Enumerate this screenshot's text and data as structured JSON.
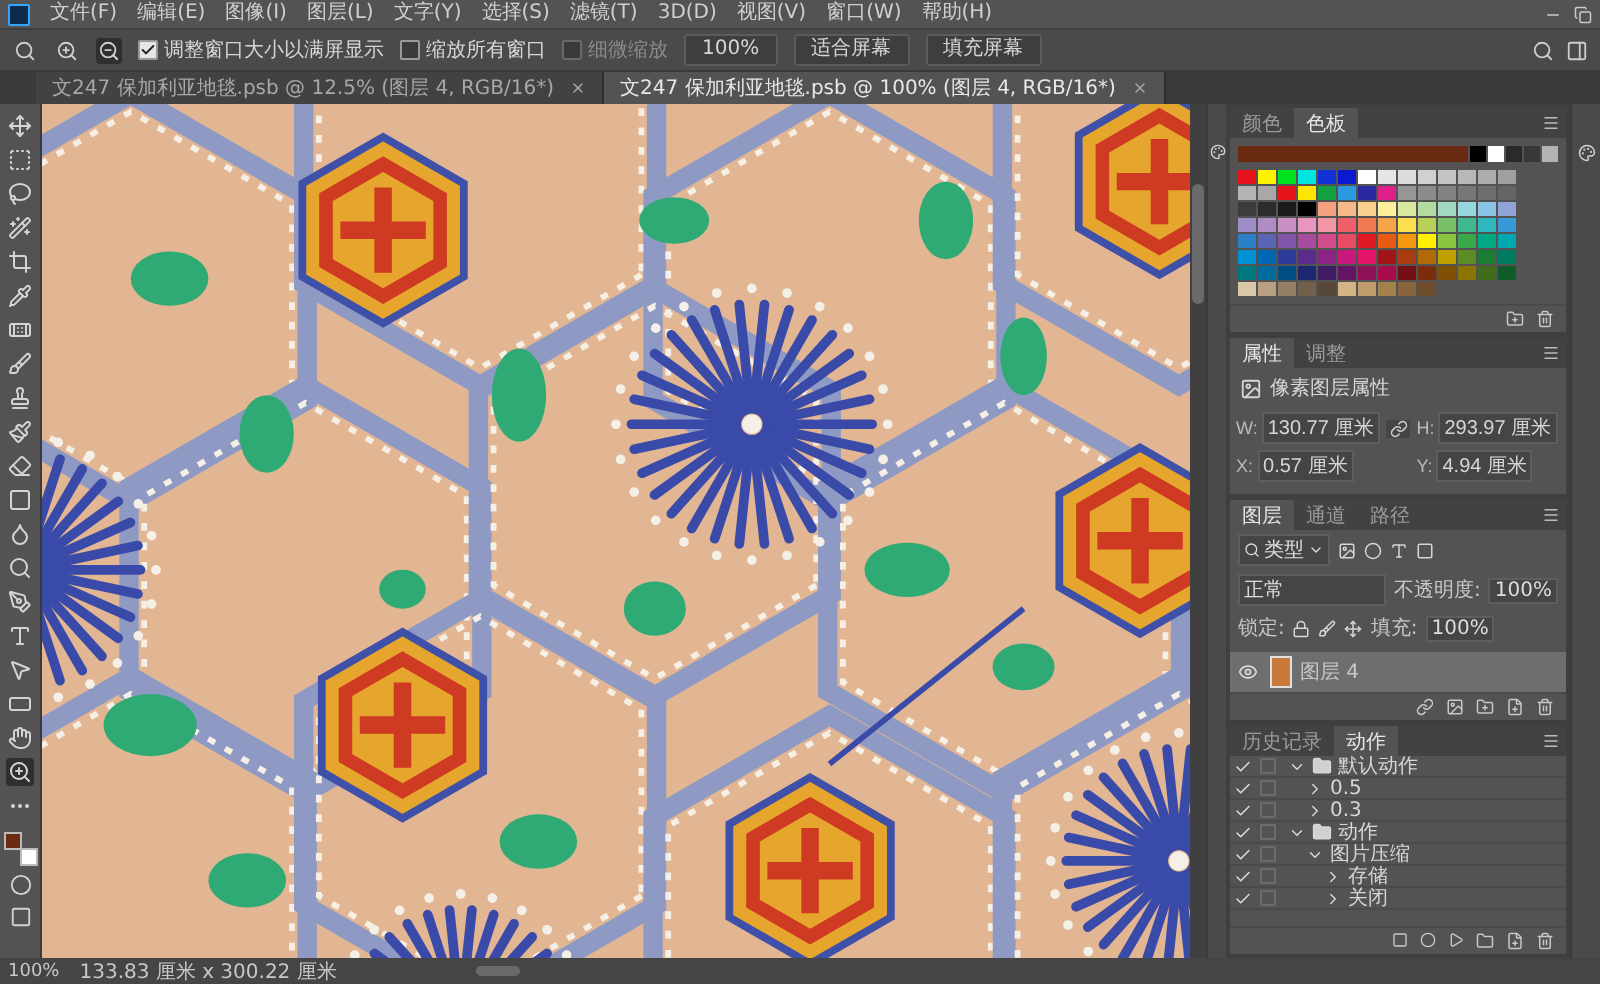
{
  "menu": [
    "文件(F)",
    "编辑(E)",
    "图像(I)",
    "图层(L)",
    "文字(Y)",
    "选择(S)",
    "滤镜(T)",
    "3D(D)",
    "视图(V)",
    "窗口(W)",
    "帮助(H)"
  ],
  "options_bar": {
    "checkboxes": [
      {
        "label": "调整窗口大小以满屏显示",
        "checked": true,
        "disabled": false
      },
      {
        "label": "缩放所有窗口",
        "checked": false,
        "disabled": false
      },
      {
        "label": "细微缩放",
        "checked": false,
        "disabled": true
      }
    ],
    "buttons": [
      "100%",
      "适合屏幕",
      "填充屏幕"
    ]
  },
  "doc_tabs": [
    {
      "label": "文247 保加利亚地毯.psb @ 12.5% (图层 4, RGB/16*)",
      "selected": false
    },
    {
      "label": "文247 保加利亚地毯.psb @ 100% (图层 4, RGB/16*)",
      "selected": true
    }
  ],
  "color_chips": [
    {
      "kind": "foreground",
      "color": "#6b2a12"
    },
    {
      "kind": "background",
      "color": "#ffffff"
    }
  ],
  "swatches_panel": {
    "tabs": [
      {
        "label": "颜色",
        "selected": false
      },
      {
        "label": "色板",
        "selected": true
      }
    ],
    "recent": [
      {
        "color": "#6b2a12"
      },
      {
        "color": "#000000"
      },
      {
        "color": "#ffffff"
      },
      {
        "color": "#2a2a2a"
      },
      {
        "color": "#383838"
      },
      {
        "color": "#b4b4b4"
      }
    ],
    "rows": [
      {
        "swatches": [
          {
            "color": "#e8141b"
          },
          {
            "color": "#fff200"
          },
          {
            "color": "#00e21f"
          },
          {
            "color": "#00e5e0"
          },
          {
            "color": "#1030d8"
          },
          {
            "color": "#0a1ad0"
          },
          {
            "color": "#ffffff"
          },
          {
            "color": "#e6e6e6"
          },
          {
            "color": "#dcdcdc"
          },
          {
            "color": "#d0d0d0"
          },
          {
            "color": "#c4c4c4"
          },
          {
            "color": "#b8b8b8"
          },
          {
            "color": "#acacac"
          },
          {
            "color": "#a0a0a0"
          }
        ]
      },
      {
        "swatches": [
          {
            "color": "#b4b4b4"
          },
          {
            "color": "#a8a8a8"
          },
          {
            "color": "#e8141c"
          },
          {
            "color": "#ffe600"
          },
          {
            "color": "#12a040"
          },
          {
            "color": "#2a9be0"
          },
          {
            "color": "#2a2aa0"
          },
          {
            "color": "#e0208a"
          },
          {
            "color": "#969696"
          },
          {
            "color": "#8c8c8c"
          },
          {
            "color": "#828282"
          },
          {
            "color": "#787878"
          },
          {
            "color": "#6e6e6e"
          },
          {
            "color": "#646464"
          }
        ]
      },
      {
        "swatches": [
          {
            "color": "#3c3c3c"
          },
          {
            "color": "#2c2c2c"
          },
          {
            "color": "#1a1a1a"
          },
          {
            "color": "#000000"
          },
          {
            "color": "#f4a27e"
          },
          {
            "color": "#f7b987"
          },
          {
            "color": "#fbd08e"
          },
          {
            "color": "#fdf09a"
          },
          {
            "color": "#d8e89c"
          },
          {
            "color": "#b4dca0"
          },
          {
            "color": "#a0d8c0"
          },
          {
            "color": "#98d6de"
          },
          {
            "color": "#8cc4e8"
          },
          {
            "color": "#90a4d8"
          }
        ]
      },
      {
        "swatches": [
          {
            "color": "#9c8cc8"
          },
          {
            "color": "#b08cc4"
          },
          {
            "color": "#c890c4"
          },
          {
            "color": "#e896c0"
          },
          {
            "color": "#f096a4"
          },
          {
            "color": "#f0606a"
          },
          {
            "color": "#f07a50"
          },
          {
            "color": "#f6a44a"
          },
          {
            "color": "#fde050"
          },
          {
            "color": "#b8d058"
          },
          {
            "color": "#78c068"
          },
          {
            "color": "#40b890"
          },
          {
            "color": "#30b8c0"
          },
          {
            "color": "#3898d8"
          }
        ]
      },
      {
        "swatches": [
          {
            "color": "#2c80c8"
          },
          {
            "color": "#5a64b4"
          },
          {
            "color": "#8054a8"
          },
          {
            "color": "#a84ca0"
          },
          {
            "color": "#d04c8c"
          },
          {
            "color": "#e84c64"
          },
          {
            "color": "#e01a22"
          },
          {
            "color": "#e85a14"
          },
          {
            "color": "#f49a10"
          },
          {
            "color": "#fff000"
          },
          {
            "color": "#8cc63e"
          },
          {
            "color": "#38a848"
          },
          {
            "color": "#00a884"
          },
          {
            "color": "#00a6b0"
          }
        ]
      },
      {
        "swatches": [
          {
            "color": "#0090d4"
          },
          {
            "color": "#0068b0"
          },
          {
            "color": "#2c3c98"
          },
          {
            "color": "#5a2c8c"
          },
          {
            "color": "#8c2488"
          },
          {
            "color": "#c8187c"
          },
          {
            "color": "#e4146a"
          },
          {
            "color": "#a01418"
          },
          {
            "color": "#a83c10"
          },
          {
            "color": "#b06a08"
          },
          {
            "color": "#c0a000"
          },
          {
            "color": "#5c8c28"
          },
          {
            "color": "#1c7c34"
          },
          {
            "color": "#007c60"
          }
        ]
      },
      {
        "swatches": [
          {
            "color": "#007880"
          },
          {
            "color": "#006c9c"
          },
          {
            "color": "#004c84"
          },
          {
            "color": "#1c2870"
          },
          {
            "color": "#401c68"
          },
          {
            "color": "#641464"
          },
          {
            "color": "#901058"
          },
          {
            "color": "#a80c4c"
          },
          {
            "color": "#741014"
          },
          {
            "color": "#7c2c0c"
          },
          {
            "color": "#805004"
          },
          {
            "color": "#8c7400"
          },
          {
            "color": "#406c1c"
          },
          {
            "color": "#105c28"
          }
        ]
      },
      {
        "swatches": [
          {
            "color": "#d8c8a8"
          },
          {
            "color": "#b8a080"
          },
          {
            "color": "#948064"
          },
          {
            "color": "#70604c"
          },
          {
            "color": "#584838"
          },
          {
            "color": "#d4b484"
          },
          {
            "color": "#c09c6c"
          },
          {
            "color": "#a4804c"
          },
          {
            "color": "#88643c"
          },
          {
            "color": "#6c4c2c"
          }
        ]
      }
    ]
  },
  "properties_panel": {
    "tabs": [
      {
        "label": "属性",
        "selected": true
      },
      {
        "label": "调整",
        "selected": false
      }
    ],
    "title": "像素图层属性",
    "fields": [
      {
        "label": "W:",
        "value": "130.77 厘米"
      },
      {
        "label": "H:",
        "value": "293.97 厘米"
      },
      {
        "label": "X:",
        "value": "0.57 厘米"
      },
      {
        "label": "Y:",
        "value": "4.94 厘米"
      }
    ]
  },
  "layers_panel": {
    "tabs": [
      {
        "label": "图层",
        "selected": true
      },
      {
        "label": "通道",
        "selected": false
      },
      {
        "label": "路径",
        "selected": false
      }
    ],
    "filter": "类型",
    "blend_mode": "正常",
    "opacity_label": "不透明度:",
    "opacity": "100%",
    "lock_label": "锁定:",
    "fill_label": "填充:",
    "fill": "100%",
    "layers": [
      {
        "name": "图层 4",
        "visible": true,
        "selected": true
      }
    ]
  },
  "actions_panel": {
    "tabs": [
      {
        "label": "历史记录",
        "selected": false
      },
      {
        "label": "动作",
        "selected": true
      }
    ],
    "items": [
      {
        "name": "默认动作",
        "folder": true,
        "checked": true,
        "expanded": true,
        "children": [
          {
            "name": "0.5",
            "folder": false,
            "checked": true,
            "expanded": false
          },
          {
            "name": "0.3",
            "folder": false,
            "checked": true,
            "expanded": false
          }
        ]
      },
      {
        "name": "动作",
        "folder": true,
        "checked": true,
        "expanded": true,
        "children": [
          {
            "name": "图片压缩",
            "folder": false,
            "checked": true,
            "expanded": true,
            "children": [
              {
                "name": "存储",
                "folder": false,
                "checked": true,
                "expanded": false
              },
              {
                "name": "关闭",
                "folder": false,
                "checked": true,
                "expanded": false
              }
            ]
          }
        ]
      }
    ]
  },
  "status_bar": {
    "zoom": "100%",
    "doc_info": "133.83 厘米 x 300.22 厘米"
  }
}
